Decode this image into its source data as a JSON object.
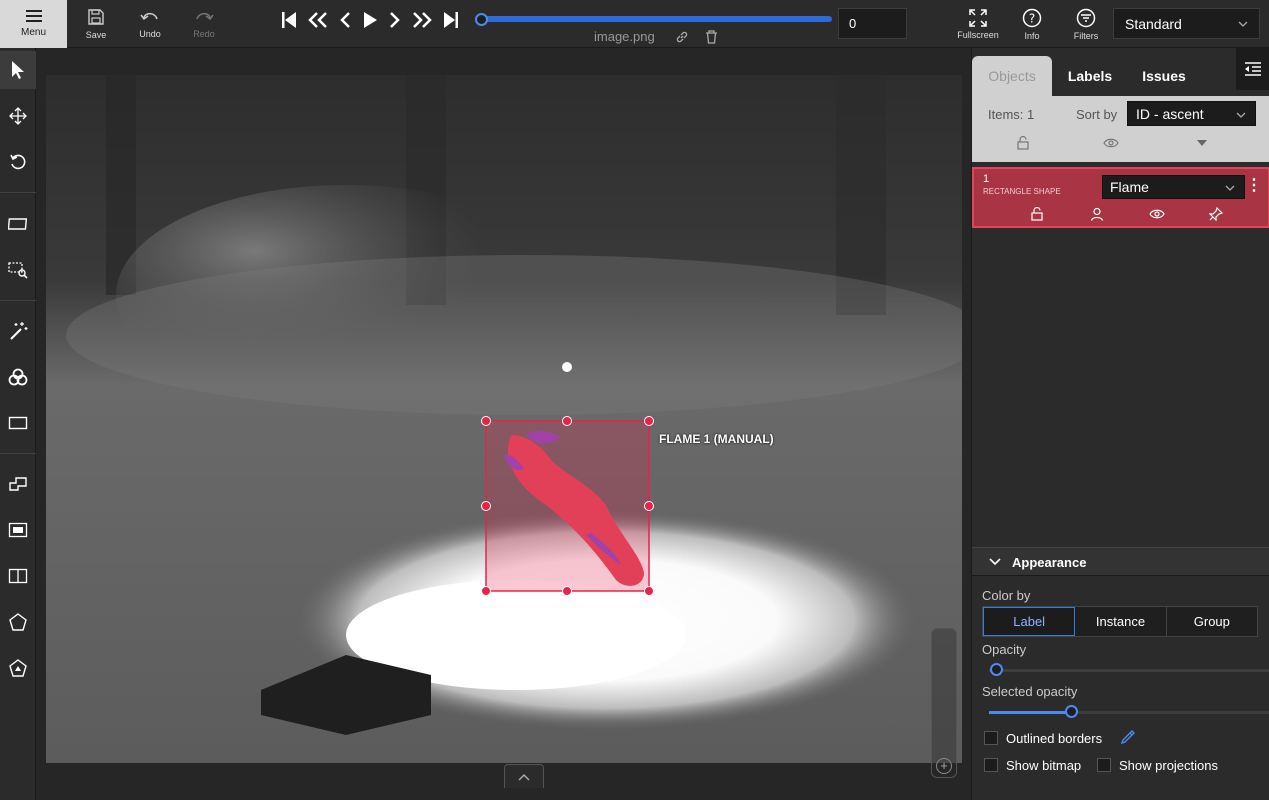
{
  "toolbar": {
    "menu": "Menu",
    "save": "Save",
    "undo": "Undo",
    "redo": "Redo",
    "frame_value": "0",
    "filename": "image.png",
    "fullscreen": "Fullscreen",
    "info": "Info",
    "filters": "Filters",
    "workspace": "Standard"
  },
  "canvas": {
    "object_label": "FLAME 1 (MANUAL)"
  },
  "panel": {
    "tabs": [
      "Objects",
      "Labels",
      "Issues"
    ],
    "items_count": "Items: 1",
    "sort_by_label": "Sort by",
    "sort_value": "ID - ascent",
    "object": {
      "id": "1",
      "type": "RECTANGLE SHAPE",
      "label": "Flame"
    },
    "appearance": {
      "title": "Appearance",
      "color_by_label": "Color by",
      "color_by_options": [
        "Label",
        "Instance",
        "Group"
      ],
      "color_by_selected": "Label",
      "opacity_label": "Opacity",
      "opacity_value": 0.0,
      "selected_opacity_label": "Selected opacity",
      "selected_opacity_value": 0.3,
      "outlined_borders": "Outlined borders",
      "show_bitmap": "Show bitmap",
      "show_projections": "Show projections"
    }
  },
  "colors": {
    "accent": "#4d8af0",
    "object_card": "#a83444",
    "shape_outline": "#e8234a"
  }
}
